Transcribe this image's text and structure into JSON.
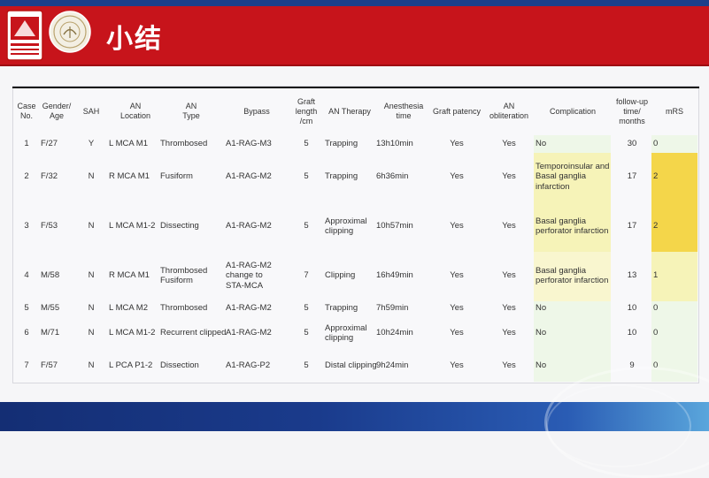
{
  "header": {
    "title": "小结"
  },
  "colors": {
    "header_red": "#c7141b",
    "highlight_light": "#f6f3b8",
    "highlight_pale": "#f9f6cf",
    "highlight_strong": "#f4d64a",
    "footer_blue": "#1a3b8c"
  },
  "table": {
    "headers": [
      {
        "lines": [
          "Case",
          "No."
        ]
      },
      {
        "lines": [
          "Gender/",
          "Age"
        ]
      },
      {
        "lines": [
          "SAH"
        ]
      },
      {
        "lines": [
          "AN",
          "Location"
        ]
      },
      {
        "lines": [
          "AN",
          "Type"
        ]
      },
      {
        "lines": [
          "Bypass"
        ]
      },
      {
        "lines": [
          "Graft",
          "length",
          "/cm"
        ]
      },
      {
        "lines": [
          "AN Therapy"
        ]
      },
      {
        "lines": [
          "Anesthesia",
          "time"
        ]
      },
      {
        "lines": [
          "Graft patency"
        ]
      },
      {
        "lines": [
          "AN",
          "obliteration"
        ]
      },
      {
        "lines": [
          "Complication"
        ]
      },
      {
        "lines": [
          "follow-up",
          "time/",
          "months"
        ]
      },
      {
        "lines": [
          "mRS"
        ]
      }
    ],
    "rows": [
      {
        "case": "1",
        "gender_age": "F/27",
        "sah": "Y",
        "location": [
          "L MCA M1"
        ],
        "type": [
          "Thrombosed"
        ],
        "bypass": [
          "A1-RAG-M3"
        ],
        "graft_length": "5",
        "therapy": [
          "Trapping"
        ],
        "anesthesia": "13h10min",
        "patency": "Yes",
        "obliteration": "Yes",
        "complication": [
          "No"
        ],
        "followup": "30",
        "mrs": "0"
      },
      {
        "case": "2",
        "gender_age": "F/32",
        "sah": "N",
        "location": [
          "R MCA M1"
        ],
        "type": [
          "Fusiform"
        ],
        "bypass": [
          "A1-RAG-M2"
        ],
        "graft_length": "5",
        "therapy": [
          "Trapping"
        ],
        "anesthesia": "6h36min",
        "patency": "Yes",
        "obliteration": "Yes",
        "complication": [
          "Temporoinsular and",
          "Basal ganglia",
          "infarction"
        ],
        "followup": "17",
        "mrs": "2"
      },
      {
        "case": "3",
        "gender_age": "F/53",
        "sah": "N",
        "location": [
          "L MCA M1-2"
        ],
        "type": [
          "Dissecting"
        ],
        "bypass": [
          "A1-RAG-M2"
        ],
        "graft_length": "5",
        "therapy": [
          "Approximal",
          "clipping"
        ],
        "anesthesia": "10h57min",
        "patency": "Yes",
        "obliteration": "Yes",
        "complication": [
          "Basal ganglia",
          "perforator infarction"
        ],
        "followup": "17",
        "mrs": "2"
      },
      {
        "case": "4",
        "gender_age": "M/58",
        "sah": "N",
        "location": [
          "R MCA M1"
        ],
        "type": [
          "Thrombosed",
          "Fusiform"
        ],
        "bypass": [
          "A1-RAG-M2",
          "change to",
          "STA-MCA"
        ],
        "graft_length": "7",
        "therapy": [
          "Clipping"
        ],
        "anesthesia": "16h49min",
        "patency": "Yes",
        "obliteration": "Yes",
        "complication": [
          "Basal ganglia",
          "perforator infarction"
        ],
        "followup": "13",
        "mrs": "1"
      },
      {
        "case": "5",
        "gender_age": "M/55",
        "sah": "N",
        "location": [
          "L MCA M2"
        ],
        "type": [
          "Thrombosed"
        ],
        "bypass": [
          "A1-RAG-M2"
        ],
        "graft_length": "5",
        "therapy": [
          "Trapping"
        ],
        "anesthesia": "7h59min",
        "patency": "Yes",
        "obliteration": "Yes",
        "complication": [
          "No"
        ],
        "followup": "10",
        "mrs": "0"
      },
      {
        "case": "6",
        "gender_age": "M/71",
        "sah": "N",
        "location": [
          "L MCA M1-2"
        ],
        "type": [
          "Recurrent clipped"
        ],
        "bypass": [
          "A1-RAG-M2"
        ],
        "graft_length": "5",
        "therapy": [
          "Approximal",
          "clipping"
        ],
        "anesthesia": "10h24min",
        "patency": "Yes",
        "obliteration": "Yes",
        "complication": [
          "No"
        ],
        "followup": "10",
        "mrs": "0"
      },
      {
        "case": "7",
        "gender_age": "F/57",
        "sah": "N",
        "location": [
          "L PCA P1-2"
        ],
        "type": [
          "Dissection"
        ],
        "bypass": [
          "A1-RAG-P2"
        ],
        "graft_length": "5",
        "therapy": [
          "Distal clipping"
        ],
        "anesthesia": "9h24min",
        "patency": "Yes",
        "obliteration": "Yes",
        "complication": [
          "No"
        ],
        "followup": "9",
        "mrs": "0"
      }
    ]
  }
}
